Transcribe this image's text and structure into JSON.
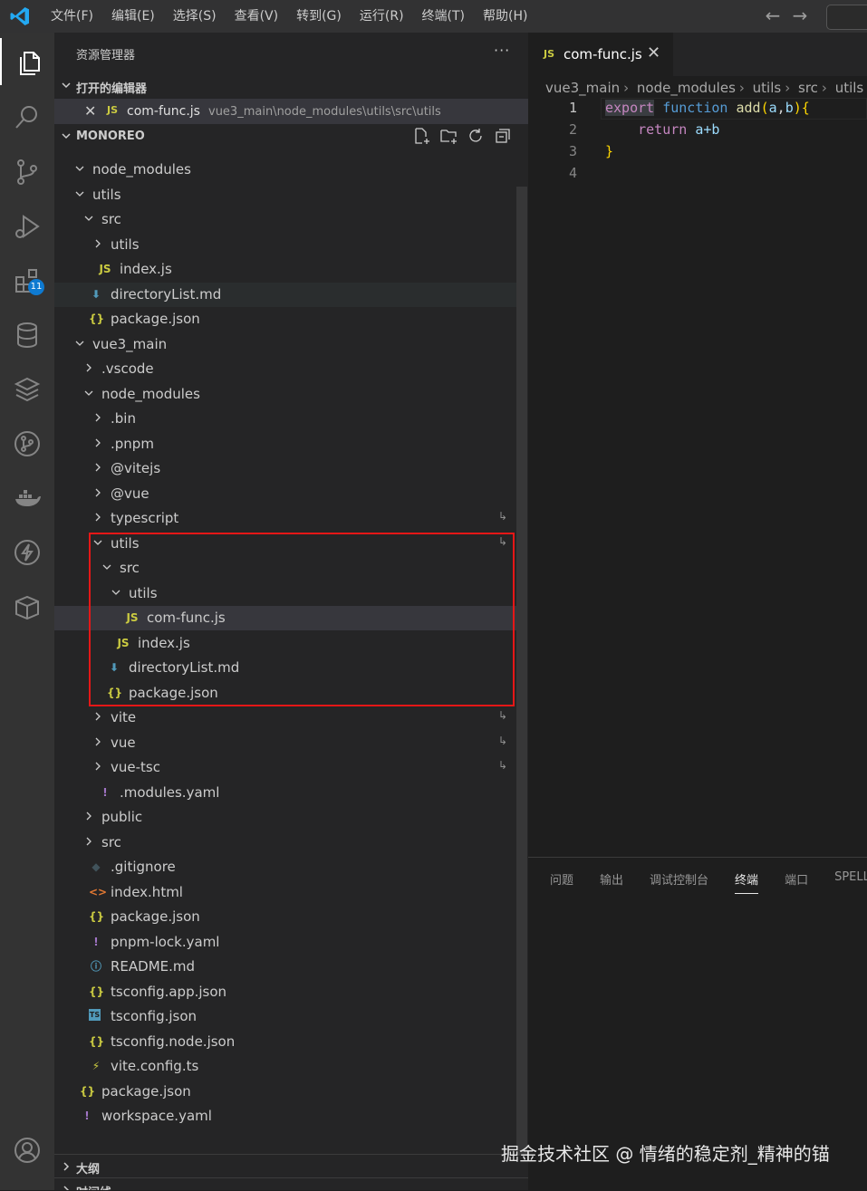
{
  "menu": [
    "文件(F)",
    "编辑(E)",
    "选择(S)",
    "查看(V)",
    "转到(G)",
    "运行(R)",
    "终端(T)",
    "帮助(H)"
  ],
  "nav": {
    "back": "←",
    "forward": "→"
  },
  "activity": {
    "extensions_badge": "11"
  },
  "sidebar": {
    "title": "资源管理器",
    "more": "···",
    "open_editors_label": "打开的编辑器",
    "open_editor": {
      "close": "✕",
      "icon": "JS",
      "name": "com-func.js",
      "path": "vue3_main\\node_modules\\utils\\src\\utils"
    },
    "workspace_label": "MONOREO",
    "outline_label": "大纲",
    "timeline_label": "时间线"
  },
  "tree": [
    {
      "name": "node_modules",
      "kind": "folder-open",
      "depth": 0
    },
    {
      "name": "utils",
      "kind": "folder-open",
      "depth": 0
    },
    {
      "name": "src",
      "kind": "folder-open",
      "depth": 1
    },
    {
      "name": "utils",
      "kind": "folder",
      "depth": 2
    },
    {
      "name": "index.js",
      "kind": "js",
      "depth": 2
    },
    {
      "name": "directoryList.md",
      "kind": "md",
      "depth": 1
    },
    {
      "name": "package.json",
      "kind": "json",
      "depth": 1
    },
    {
      "name": "vue3_main",
      "kind": "folder-open",
      "depth": 0
    },
    {
      "name": ".vscode",
      "kind": "folder",
      "depth": 1
    },
    {
      "name": "node_modules",
      "kind": "folder-open",
      "depth": 1
    },
    {
      "name": ".bin",
      "kind": "folder",
      "depth": 2
    },
    {
      "name": ".pnpm",
      "kind": "folder",
      "depth": 2
    },
    {
      "name": "@vitejs",
      "kind": "folder",
      "depth": 2
    },
    {
      "name": "@vue",
      "kind": "folder",
      "depth": 2
    },
    {
      "name": "typescript",
      "kind": "folder",
      "depth": 2,
      "link": "↳"
    },
    {
      "name": "utils",
      "kind": "folder-open",
      "depth": 2,
      "link": "↳"
    },
    {
      "name": "src",
      "kind": "folder-open",
      "depth": 3
    },
    {
      "name": "utils",
      "kind": "folder-open",
      "depth": 4
    },
    {
      "name": "com-func.js",
      "kind": "js",
      "depth": 5,
      "selected": true
    },
    {
      "name": "index.js",
      "kind": "js",
      "depth": 4
    },
    {
      "name": "directoryList.md",
      "kind": "md",
      "depth": 3
    },
    {
      "name": "package.json",
      "kind": "json",
      "depth": 3
    },
    {
      "name": "vite",
      "kind": "folder",
      "depth": 2,
      "link": "↳"
    },
    {
      "name": "vue",
      "kind": "folder",
      "depth": 2,
      "link": "↳"
    },
    {
      "name": "vue-tsc",
      "kind": "folder",
      "depth": 2,
      "link": "↳"
    },
    {
      "name": ".modules.yaml",
      "kind": "yaml",
      "depth": 2
    },
    {
      "name": "public",
      "kind": "folder",
      "depth": 1
    },
    {
      "name": "src",
      "kind": "folder",
      "depth": 1
    },
    {
      "name": ".gitignore",
      "kind": "git",
      "depth": 1
    },
    {
      "name": "index.html",
      "kind": "html",
      "depth": 1
    },
    {
      "name": "package.json",
      "kind": "json",
      "depth": 1
    },
    {
      "name": "pnpm-lock.yaml",
      "kind": "yaml",
      "depth": 1
    },
    {
      "name": "README.md",
      "kind": "info",
      "depth": 1
    },
    {
      "name": "tsconfig.app.json",
      "kind": "json",
      "depth": 1
    },
    {
      "name": "tsconfig.json",
      "kind": "ts",
      "depth": 1
    },
    {
      "name": "tsconfig.node.json",
      "kind": "json",
      "depth": 1
    },
    {
      "name": "vite.config.ts",
      "kind": "vite",
      "depth": 1
    },
    {
      "name": "package.json",
      "kind": "json",
      "depth": 0
    },
    {
      "name": "workspace.yaml",
      "kind": "yaml",
      "depth": 0
    }
  ],
  "editor": {
    "tab": {
      "icon": "JS",
      "name": "com-func.js",
      "close": "✕"
    },
    "breadcrumbs": [
      "vue3_main",
      "node_modules",
      "utils",
      "src",
      "utils"
    ],
    "line_numbers": [
      "1",
      "2",
      "3",
      "4"
    ],
    "code": {
      "l1_export": "export",
      "l1_function": "function",
      "l1_name": "add",
      "l1_open": "(",
      "l1_a": "a",
      "l1_comma": ",",
      "l1_b": "b",
      "l1_close": ")",
      "l1_brace": "{",
      "l2_return": "return",
      "l2_expr": "a+b",
      "l3_brace": "}"
    }
  },
  "panel": {
    "tabs": [
      "问题",
      "输出",
      "调试控制台",
      "终端",
      "端口",
      "SPELL"
    ],
    "active": "终端"
  },
  "watermark": "掘金技术社区 @ 情绪的稳定剂_精神的锚",
  "colors": {
    "accent": "#0e7ad1",
    "highlight_box": "#e51717",
    "js_icon": "#cbcb41",
    "json_icon": "#cbcb41",
    "md_icon": "#519aba",
    "yaml_icon": "#a074c4",
    "html_icon": "#e37933"
  }
}
